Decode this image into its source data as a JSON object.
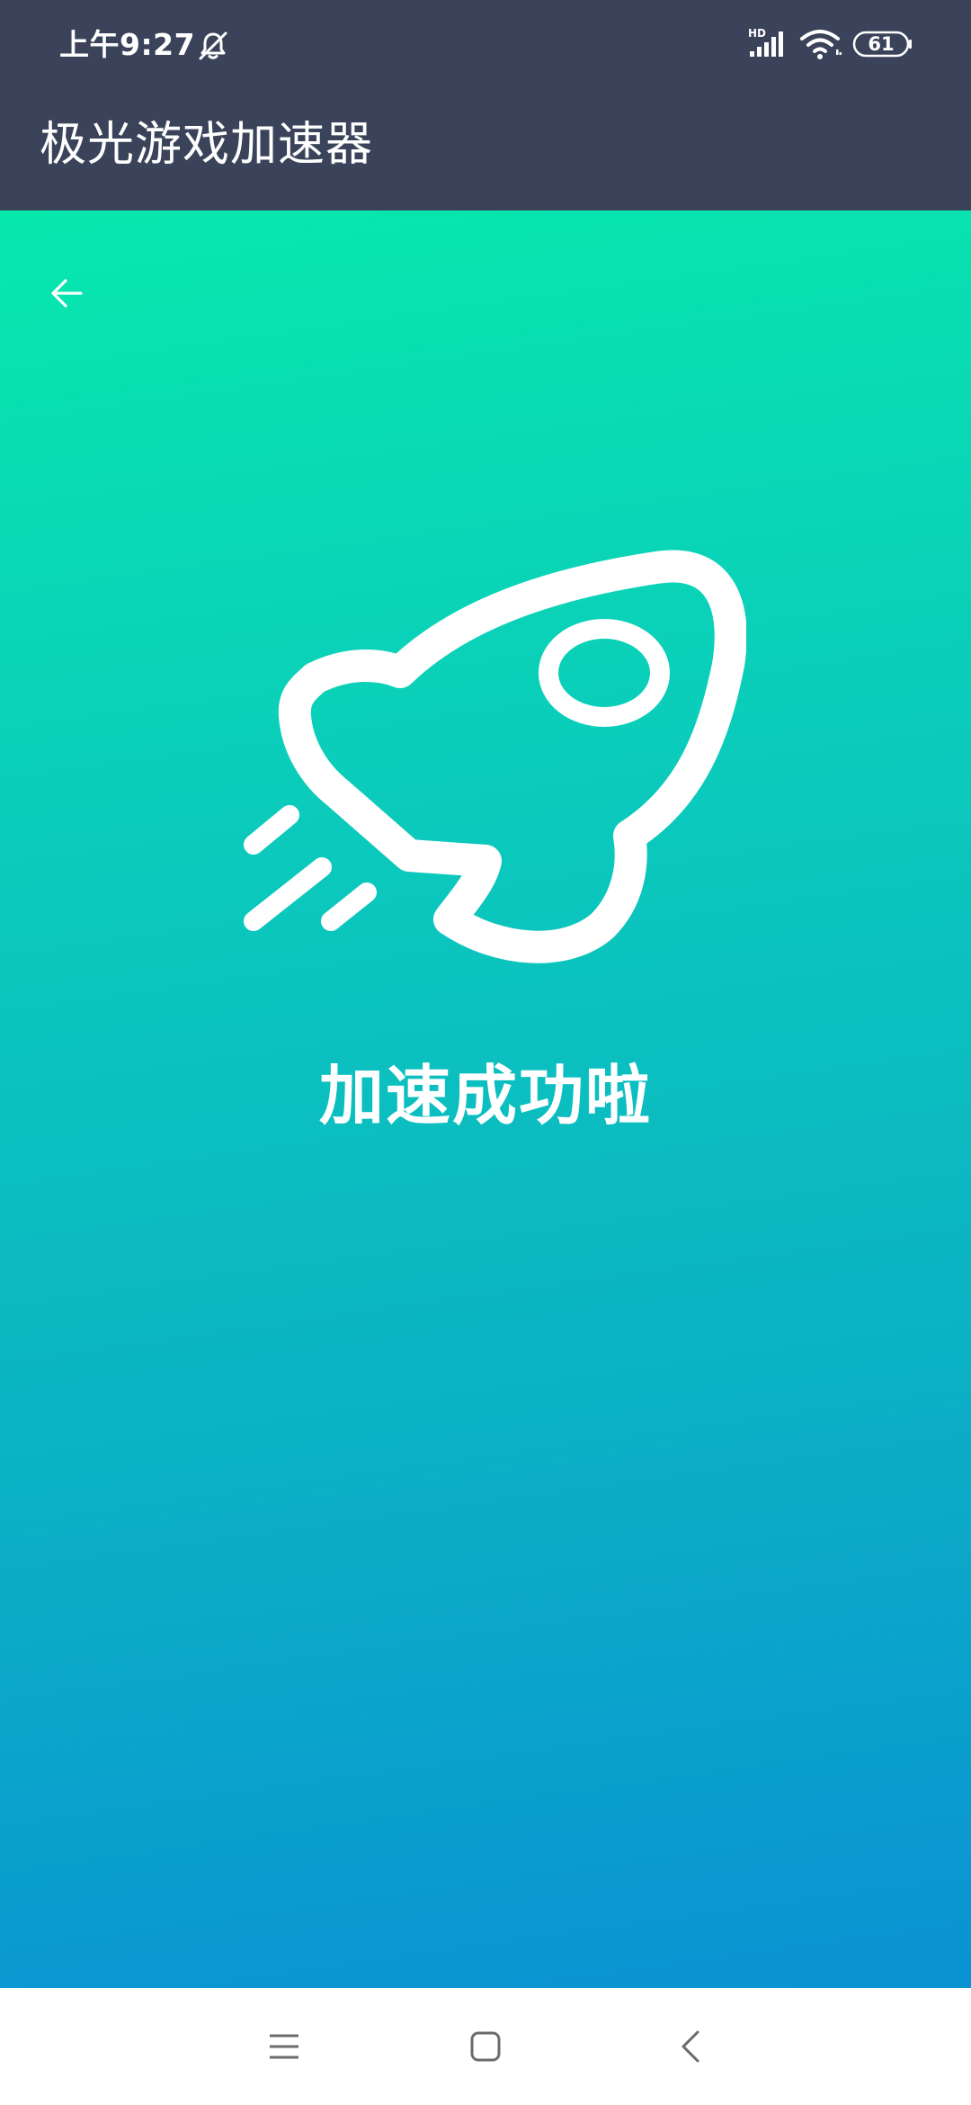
{
  "status_bar": {
    "time": "上午9:27",
    "network_badge": "HD",
    "battery_level": "61",
    "icons": [
      "bell-off-icon",
      "signal-icon",
      "wifi-icon",
      "battery-icon"
    ]
  },
  "app_bar": {
    "title": "极光游戏加速器"
  },
  "content": {
    "back_icon": "arrow-left-icon",
    "hero_icon": "rocket-icon",
    "message": "加速成功啦"
  },
  "nav_bar": {
    "icons": [
      "menu-icon",
      "home-square-icon",
      "back-chevron-icon"
    ]
  },
  "colors": {
    "header_bg": "#3a4359",
    "gradient_top": "#07e8ad",
    "gradient_bottom": "#0a92d3",
    "nav_icon": "#6b6b6b",
    "foreground": "#ffffff"
  }
}
